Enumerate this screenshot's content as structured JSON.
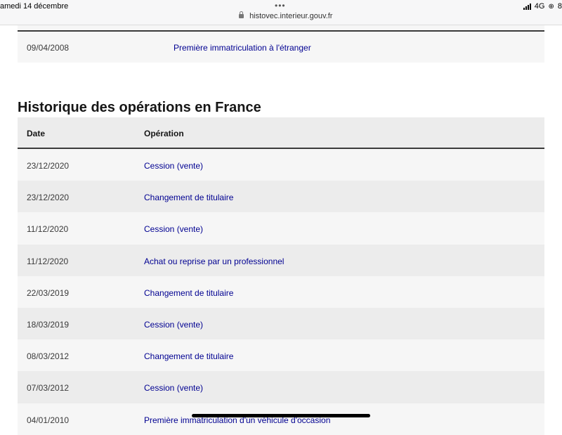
{
  "statusbar": {
    "time": "amedi 14 décembre",
    "dots": "•••",
    "url": "histovec.interieur.gouv.fr",
    "network": "4G",
    "extra_glyph": "⊕",
    "battery_fragment": "8"
  },
  "top_table": {
    "row": {
      "date": "09/04/2008",
      "operation": "Première immatriculation à l'étranger"
    }
  },
  "section": {
    "title": "Historique des opérations en France"
  },
  "ops_table": {
    "headers": {
      "date": "Date",
      "operation": "Opération"
    },
    "rows": [
      {
        "date": "23/12/2020",
        "operation": "Cession (vente)"
      },
      {
        "date": "23/12/2020",
        "operation": "Changement de titulaire"
      },
      {
        "date": "11/12/2020",
        "operation": "Cession (vente)"
      },
      {
        "date": "11/12/2020",
        "operation": "Achat ou reprise par un professionnel"
      },
      {
        "date": "22/03/2019",
        "operation": "Changement de titulaire"
      },
      {
        "date": "18/03/2019",
        "operation": "Cession (vente)"
      },
      {
        "date": "08/03/2012",
        "operation": "Changement de titulaire"
      },
      {
        "date": "07/03/2012",
        "operation": "Cession (vente)"
      },
      {
        "date": "04/01/2010",
        "operation": "Première immatriculation d'un véhicule d'occasion"
      }
    ]
  },
  "colors": {
    "link": "#000091",
    "row_light": "#f6f6f6",
    "row_dark": "#ececec",
    "rule": "#3a3a3a"
  }
}
